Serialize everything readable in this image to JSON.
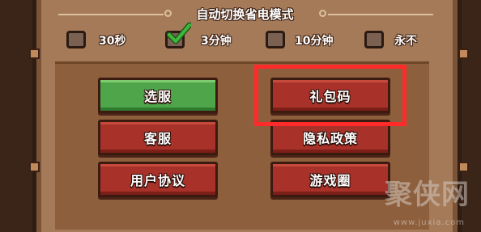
{
  "header": {
    "title": "自动切换省电模式"
  },
  "power_saving_options": [
    {
      "label": "30秒",
      "checked": false
    },
    {
      "label": "3分钟",
      "checked": true
    },
    {
      "label": "10分钟",
      "checked": false
    },
    {
      "label": "永不",
      "checked": false
    }
  ],
  "buttons": {
    "select_server": "选服",
    "gift_code": "礼包码",
    "customer_service": "客服",
    "privacy_policy": "隐私政策",
    "user_agreement": "用户协议",
    "game_circle": "游戏圈"
  },
  "watermark": {
    "text": "聚侠网",
    "url": "www.juxia.com"
  },
  "colors": {
    "button_red": "#a8322a",
    "button_green": "#4fa64a",
    "highlight_box": "#ff2b2b",
    "check_mark": "#3fb83a"
  }
}
